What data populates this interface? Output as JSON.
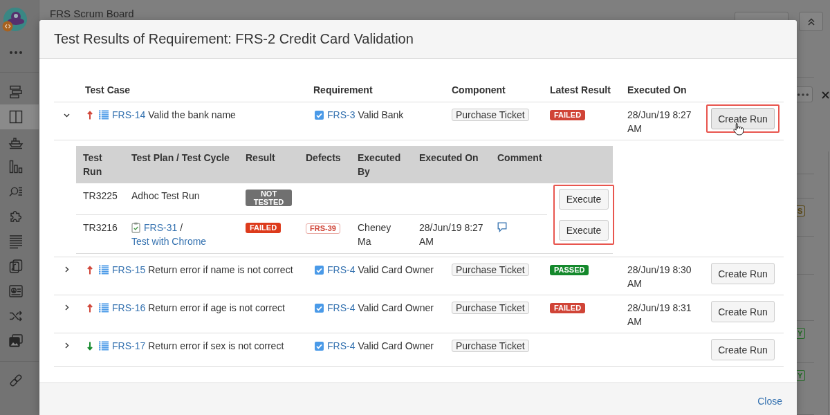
{
  "sidebar": {
    "items": [
      {
        "kind": "roadmap",
        "selected": false
      },
      {
        "kind": "board",
        "selected": true
      },
      {
        "kind": "releases",
        "selected": false
      },
      {
        "kind": "reports",
        "selected": false
      },
      {
        "kind": "search",
        "selected": false
      },
      {
        "kind": "addons",
        "selected": false
      },
      {
        "kind": "pages",
        "selected": false
      },
      {
        "kind": "files",
        "selected": false
      },
      {
        "kind": "contacts",
        "selected": false
      },
      {
        "kind": "shuffle",
        "selected": false
      },
      {
        "kind": "gallery",
        "selected": false
      }
    ],
    "bottom_items": [
      {
        "kind": "link",
        "selected": false
      }
    ]
  },
  "board": {
    "title": "FRS Scrum Board",
    "side_badges": [
      {
        "text": "S",
        "color": "#5a4712"
      },
      {
        "text": "Y",
        "color": "#1f6b22"
      },
      {
        "text": "Y",
        "color": "#1f6b22"
      }
    ]
  },
  "dialog": {
    "title": "Test Results of Requirement: FRS-2 Credit Card Validation",
    "columns": [
      "Test Case",
      "Requirement",
      "Component",
      "Latest Result",
      "Executed On"
    ],
    "rows": [
      {
        "expanded": true,
        "priority": {
          "kind": "high"
        },
        "key": "FRS-14",
        "summary": "Valid the bank name",
        "requirement": {
          "key": "FRS-3",
          "name": "Valid Bank"
        },
        "component": "Purchase Ticket",
        "latest_result": {
          "text": "FAILED",
          "kind": "failed"
        },
        "executed_on": "28/Jun/19 8:27 AM",
        "action": "Create Run",
        "highlighted": true,
        "action_hovered": true,
        "runs": {
          "columns": [
            "Test Run",
            "Test Plan / Test Cycle",
            "Result",
            "Defects",
            "Executed By",
            "Executed On",
            "Comment"
          ],
          "actions_highlighted": true,
          "rows": [
            {
              "id": "TR3225",
              "plan": {
                "kind": "adhoc",
                "name": "Adhoc Test Run"
              },
              "result": {
                "text": "NOT TESTED",
                "kind": "not-tested"
              },
              "has_comment": false,
              "action": "Execute"
            },
            {
              "id": "TR3216",
              "plan": {
                "kind": "linked",
                "key": "FRS-31",
                "separator": "/",
                "cycle": "Test with Chrome"
              },
              "result": {
                "text": "FAILED",
                "kind": "failed"
              },
              "defects": [
                "FRS-39"
              ],
              "executed_by": "Cheney Ma",
              "executed_on": "28/Jun/19 8:27 AM",
              "has_comment": true,
              "action": "Execute"
            }
          ]
        }
      },
      {
        "expanded": false,
        "priority": {
          "kind": "high"
        },
        "key": "FRS-15",
        "summary": "Return error if name is not correct",
        "requirement": {
          "key": "FRS-4",
          "name": "Valid Card Owner"
        },
        "component": "Purchase Ticket",
        "latest_result": {
          "text": "PASSED",
          "kind": "passed"
        },
        "executed_on": "28/Jun/19 8:30 AM",
        "action": "Create Run",
        "highlighted": false,
        "action_hovered": false
      },
      {
        "expanded": false,
        "priority": {
          "kind": "high"
        },
        "key": "FRS-16",
        "summary": "Return error if age is not correct",
        "requirement": {
          "key": "FRS-4",
          "name": "Valid Card Owner"
        },
        "component": "Purchase Ticket",
        "latest_result": {
          "text": "FAILED",
          "kind": "failed"
        },
        "executed_on": "28/Jun/19 8:31 AM",
        "action": "Create Run",
        "highlighted": false,
        "action_hovered": false
      },
      {
        "expanded": false,
        "priority": {
          "kind": "low"
        },
        "key": "FRS-17",
        "summary": "Return error if sex is not correct",
        "requirement": {
          "key": "FRS-4",
          "name": "Valid Card Owner"
        },
        "component": "Purchase Ticket",
        "action": "Create Run",
        "highlighted": false,
        "action_hovered": false
      }
    ],
    "close": "Close"
  }
}
